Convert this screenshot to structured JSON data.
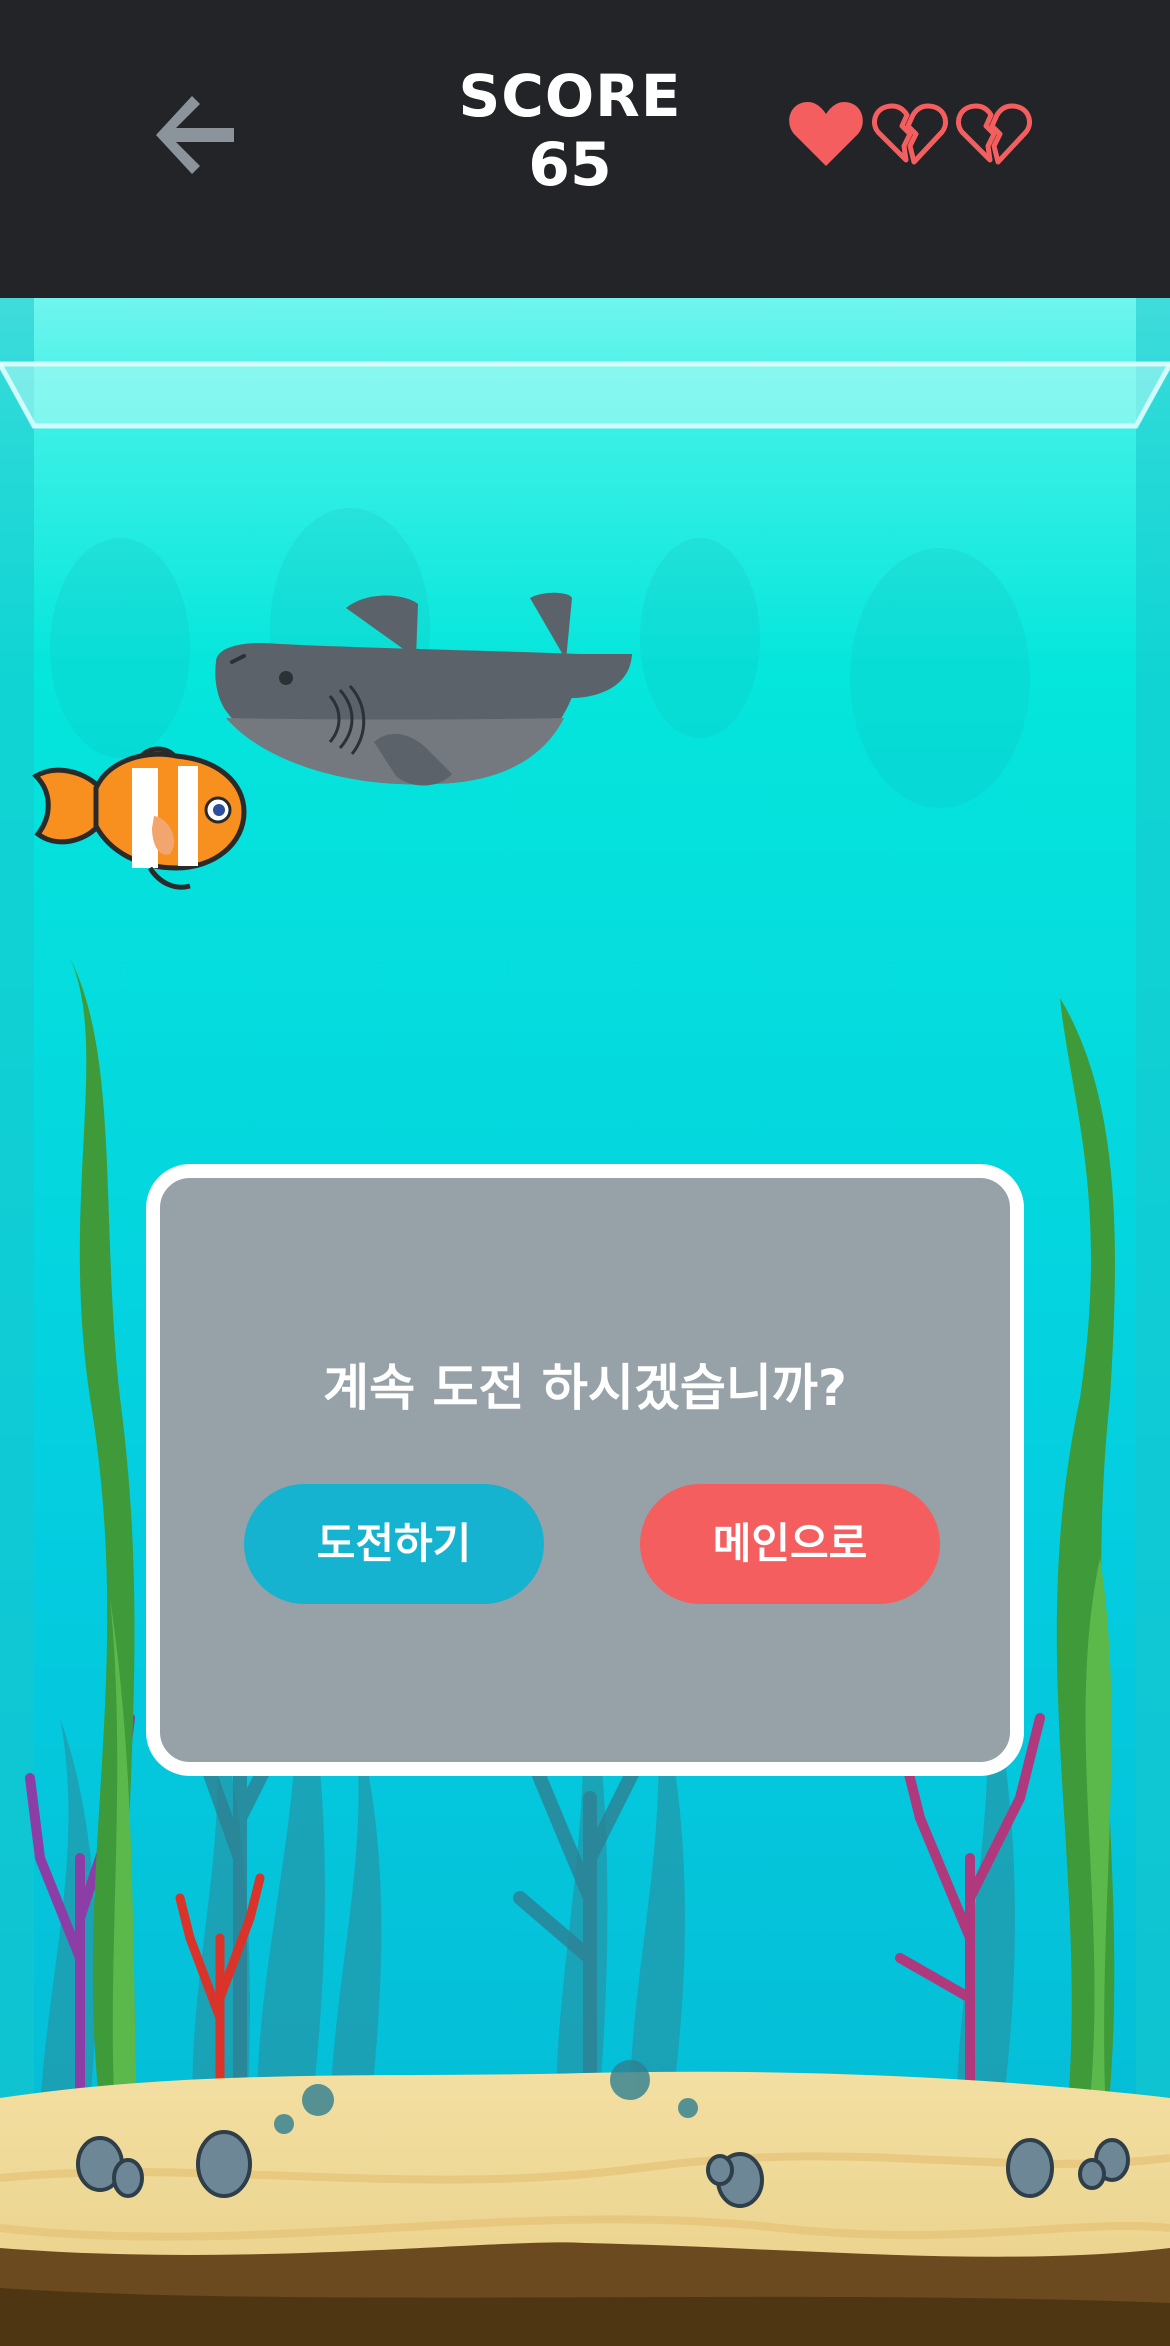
{
  "header": {
    "score_label": "SCORE",
    "score_value": "65",
    "lives_total": 3,
    "lives_remaining": 1
  },
  "dialog": {
    "title": "계속 도전 하시겠습니까?",
    "retry_label": "도전하기",
    "main_label": "메인으로"
  },
  "colors": {
    "topbar": "#222428",
    "water_top": "#5ff3ea",
    "water_bottom": "#06b7d2",
    "heart": "#f45e5e",
    "dialog_bg": "#96a1a8",
    "retry": "#16b3d1",
    "main": "#f45e5e"
  }
}
